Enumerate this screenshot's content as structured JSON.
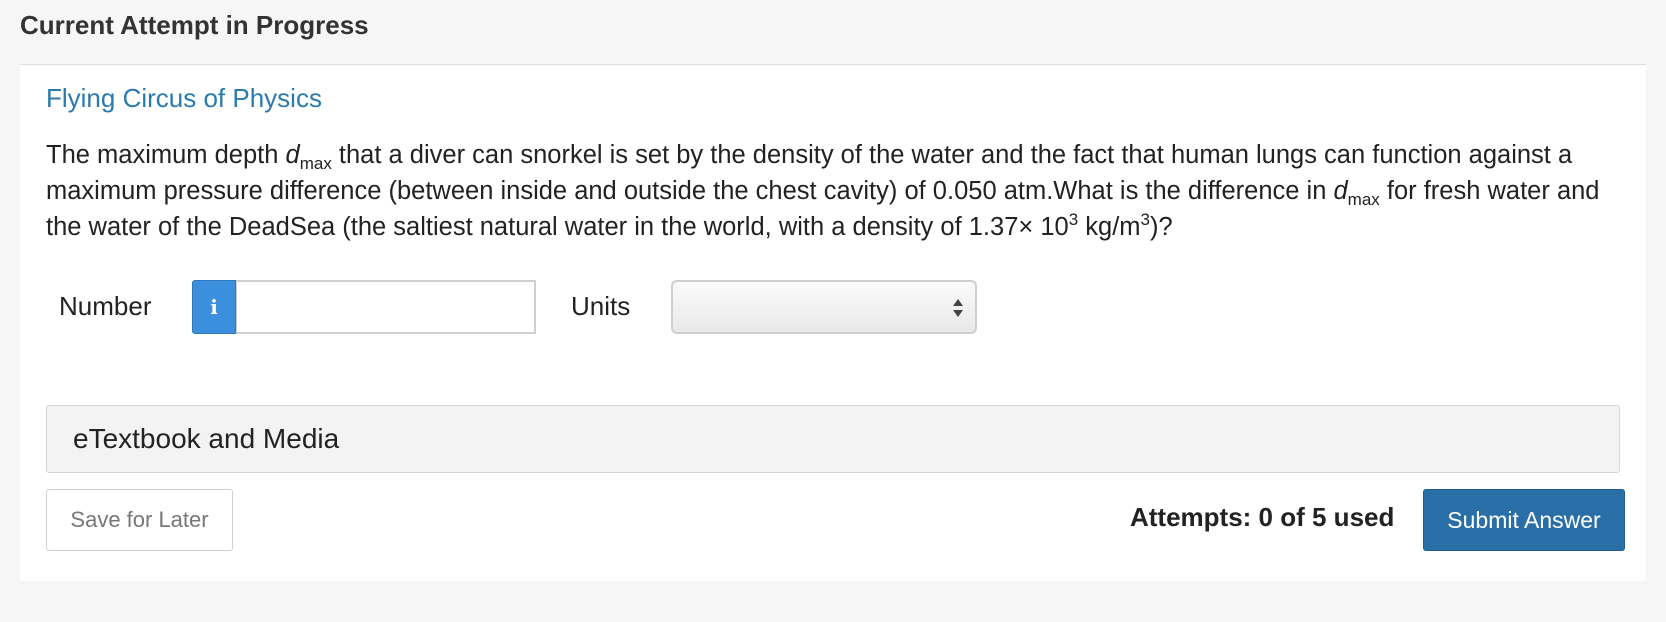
{
  "header": {
    "title": "Current Attempt in Progress"
  },
  "question": {
    "section_title": "Flying Circus of Physics",
    "text_1": "The maximum depth ",
    "var_d": "d",
    "var_sub": "max",
    "text_2": " that a diver can snorkel is set by the density of the water and the fact that human lungs can function against a maximum pressure difference (between inside and outside the chest cavity) of 0.050 atm.What is the difference in ",
    "text_3": " for fresh water and the water of the DeadSea (the saltiest natural water in the world, with a density of 1.37× 10",
    "exp_3a": "3",
    "text_4": " kg/m",
    "exp_3b": "3",
    "text_5": ")?"
  },
  "answer": {
    "number_label": "Number",
    "info_icon": "i",
    "number_value": "",
    "units_label": "Units",
    "units_value": ""
  },
  "resources": {
    "etextbook_label": "eTextbook and Media"
  },
  "footer": {
    "save_label": "Save for Later",
    "attempts_text": "Attempts: 0 of 5 used",
    "submit_label": "Submit Answer"
  },
  "colors": {
    "link_blue": "#2a7ab0",
    "info_blue": "#3b8fdc",
    "submit_blue": "#2a6ea8"
  }
}
